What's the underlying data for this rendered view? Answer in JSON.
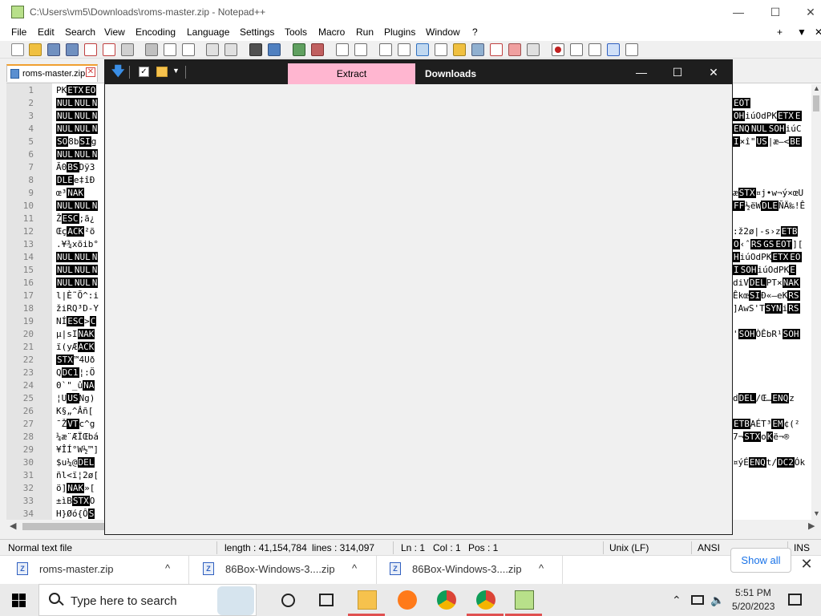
{
  "notepad": {
    "title": "C:\\Users\\vm5\\Downloads\\roms-master.zip - Notepad++",
    "menu": [
      "File",
      "Edit",
      "Search",
      "View",
      "Encoding",
      "Language",
      "Settings",
      "Tools",
      "Macro",
      "Run",
      "Plugins",
      "Window",
      "?"
    ],
    "title_controls": [
      "+",
      "▼",
      "✕"
    ],
    "tab": {
      "label": "roms-master.zip",
      "close": "✕"
    },
    "line_numbers": [
      "1",
      "2",
      "3",
      "4",
      "5",
      "6",
      "7",
      "8",
      "9",
      "10",
      "11",
      "12",
      "13",
      "14",
      "15",
      "16",
      "17",
      "18",
      "19",
      "20",
      "21",
      "22",
      "23",
      "24",
      "25",
      "26",
      "27",
      "28",
      "29",
      "30",
      "31",
      "32",
      "33",
      "34"
    ],
    "left_lines": [
      "PK[ETX][EO]",
      "[NUL][NUL][N",
      "[NUL][NUL][N",
      "[NUL][NUL][N",
      "[SO]8b[SI]g",
      "[NUL][NUL][N",
      "Ã0[BS]Dÿ3",
      "[DLE]e‡îÐ",
      "œ³[NAK]",
      "[NUL][NUL][N",
      "Ž[ESC];ã¿",
      "Œç[ACK]²õ",
      ".¥¾xõib°",
      "[NUL][NUL][N",
      "[NUL][NUL][N",
      "[NUL][NUL][N",
      "l|È˜Õ^:i",
      "žiRQ³D-Y",
      "NÍ[ESC]>[C",
      "µ|sI[NAK]",
      "ï(yÆ[ACK]",
      "[STX]™4Uð",
      "Q[DC1]¦:Ö",
      "0`\"_û[NA",
      "¦U[US]Ng)",
      "K§„^Âñ[",
      "¯Ž[VT]c^g",
      "¼æ¨ÆÏŒbá",
      "¥ÎÍ°W½™]",
      "$u¼@[DEL]",
      "ñl<ï¦2ø[",
      "ö][NAK]»[",
      "±ìB[STX]O",
      "H}Øó{Ô[S"
    ],
    "right_lines": [
      "",
      "[EOT]",
      "[OH]iúOdPK[ETX][E",
      "[ENQ][NUL][SOH]iúC",
      "[I]×î\"[US]|æ–<[BE",
      "",
      "",
      "",
      "æ[STX]¤j•w¬ý×œU",
      "[FF]½ëW[DLE]ÑÄ‰!Ê",
      "",
      ":ž2ø|-s›z[ETB]",
      "[O]‹ˆ[RS][GS][EOT]][",
      "[H]iúOdPK[ETX][EO",
      "[I][SOH]iúOdPK[E",
      "diV[DEL]PT×[NAK]",
      "Êkœ[SI]Ð«–eK[RS",
      "]AwS'T[SYN]i[RS",
      "",
      "'[SOH]ÒÊbR¹[SOH]",
      "",
      "",
      "",
      "",
      "d[DEL]/Œ…[ENQ]z",
      "",
      "[ETB]AÉT³[EM]¢(²",
      "7¬[STX]o[Kë¬®",
      "",
      "¤ýÉ[ENQ]t/[DC2]Ók",
      "",
      "",
      "",
      ""
    ],
    "status": {
      "type": "Normal text file",
      "length": "length : 41,154,784",
      "lines": "lines : 314,097",
      "ln": "Ln : 1",
      "col": "Col : 1",
      "pos": "Pos : 1",
      "eol": "Unix (LF)",
      "encoding": "ANSI",
      "mode": "INS"
    }
  },
  "extract_window": {
    "tab_extract": "Extract",
    "tab_downloads": "Downloads",
    "controls": [
      "—",
      "☐",
      "✕"
    ],
    "accent_color": "#ffb6d0",
    "titlebar_color": "#1e1e1e"
  },
  "downloads_bar": {
    "items": [
      {
        "name": "roms-master.zip",
        "chev": "^"
      },
      {
        "name": "86Box-Windows-3....zip",
        "chev": "^"
      },
      {
        "name": "86Box-Windows-3....zip",
        "chev": "^"
      }
    ],
    "show_all": "Show all",
    "close": "✕"
  },
  "taskbar": {
    "search_placeholder": "Type here to search",
    "time": "5:51 PM",
    "date": "5/20/2023"
  }
}
